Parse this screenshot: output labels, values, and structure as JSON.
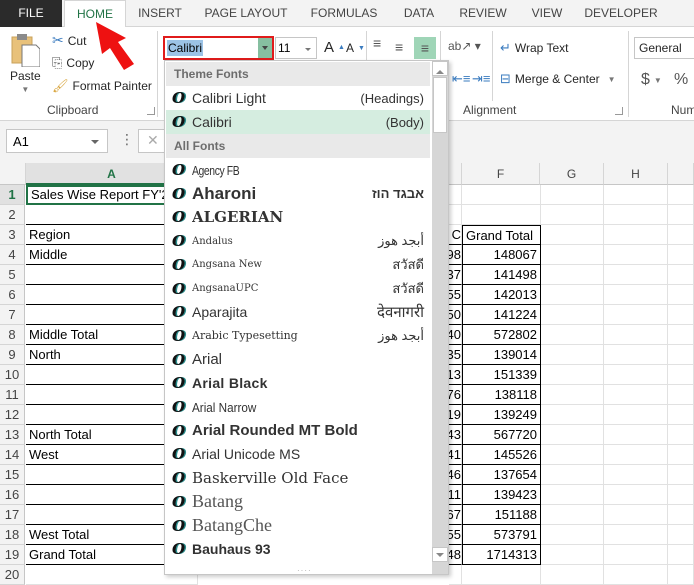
{
  "tabs": [
    {
      "label": "FILE",
      "active": false
    },
    {
      "label": "HOME",
      "active": true
    },
    {
      "label": "INSERT",
      "active": false
    },
    {
      "label": "PAGE LAYOUT",
      "active": false
    },
    {
      "label": "FORMULAS",
      "active": false
    },
    {
      "label": "DATA",
      "active": false
    },
    {
      "label": "REVIEW",
      "active": false
    },
    {
      "label": "VIEW",
      "active": false
    },
    {
      "label": "DEVELOPER",
      "active": false
    }
  ],
  "ribbon": {
    "clipboard": {
      "paste": "Paste",
      "cut": "Cut",
      "copy": "Copy",
      "format_painter": "Format Painter",
      "group_label": "Clipboard"
    },
    "font": {
      "font_name": "Calibri",
      "font_size": "11",
      "grow_icon": "A",
      "shrink_icon": "A"
    },
    "alignment": {
      "wrap_text": "Wrap Text",
      "merge_center": "Merge & Center",
      "group_label": "Alignment"
    },
    "number": {
      "format": "General",
      "currency": "$",
      "percent": "%",
      "group_label": "Num"
    }
  },
  "formula_bar": {
    "name_box": "A1",
    "dots": "⋮",
    "cancel": "✕"
  },
  "grid": {
    "columns": [
      "A",
      "F",
      "G",
      "H"
    ],
    "rows": [
      "1",
      "2",
      "3",
      "4",
      "5",
      "6",
      "7",
      "8",
      "9",
      "10",
      "11",
      "12",
      "13",
      "14",
      "15",
      "16",
      "17",
      "18",
      "19",
      "20"
    ],
    "col_a": [
      "Sales Wise Report FY'2",
      "",
      "Region",
      "Middle",
      "",
      "",
      "",
      "Middle Total",
      "North",
      "",
      "",
      "",
      "North Total",
      "West",
      "",
      "",
      "",
      "West Total",
      "Grand Total",
      ""
    ],
    "col_e_partial": [
      "",
      "",
      "C",
      "98",
      "37",
      "55",
      "50",
      "40",
      "35",
      "13",
      "76",
      "19",
      "43",
      "41",
      "46",
      "11",
      "67",
      "55",
      "48",
      ""
    ],
    "col_f": [
      "",
      "",
      "Grand Total",
      "148067",
      "141498",
      "142013",
      "141224",
      "572802",
      "139014",
      "151339",
      "138118",
      "139249",
      "567720",
      "145526",
      "137654",
      "139423",
      "151188",
      "573791",
      "1714313",
      ""
    ]
  },
  "font_dropdown": {
    "theme_header": "Theme Fonts",
    "all_header": "All Fonts",
    "theme_fonts": [
      {
        "name": "Calibri Light",
        "sample": "(Headings)",
        "selected": false
      },
      {
        "name": "Calibri",
        "sample": "(Body)",
        "selected": true
      }
    ],
    "all_fonts": [
      {
        "name": "Agency FB",
        "sample": ""
      },
      {
        "name": "Aharoni",
        "sample": "אבגד הוז"
      },
      {
        "name": "ALGERIAN",
        "sample": ""
      },
      {
        "name": "Andalus",
        "sample": "أبجد هوز"
      },
      {
        "name": "Angsana New",
        "sample": "สวัสดี"
      },
      {
        "name": "AngsanaUPC",
        "sample": "สวัสดี"
      },
      {
        "name": "Aparajita",
        "sample": "देवनागरी"
      },
      {
        "name": "Arabic Typesetting",
        "sample": "أبجد هوز"
      },
      {
        "name": "Arial",
        "sample": ""
      },
      {
        "name": "Arial Black",
        "sample": ""
      },
      {
        "name": "Arial Narrow",
        "sample": ""
      },
      {
        "name": "Arial Rounded MT Bold",
        "sample": ""
      },
      {
        "name": "Arial Unicode MS",
        "sample": ""
      },
      {
        "name": "Baskerville Old Face",
        "sample": ""
      },
      {
        "name": "Batang",
        "sample": ""
      },
      {
        "name": "BatangChe",
        "sample": ""
      },
      {
        "name": "Bauhaus 93",
        "sample": ""
      }
    ],
    "grip": "····"
  },
  "colors": {
    "accent_green": "#217346",
    "highlight_red": "#e01b1b",
    "selected_item": "#d5ede0"
  }
}
